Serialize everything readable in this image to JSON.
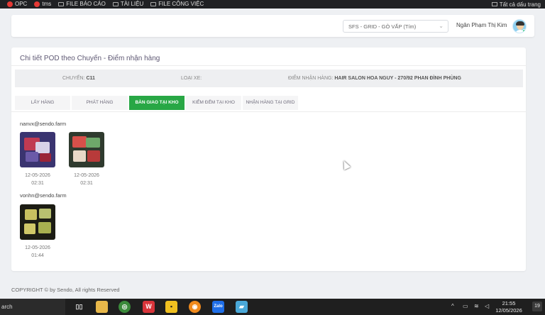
{
  "bookmarks": [
    {
      "label": "OPC",
      "icon": "red-app-icon"
    },
    {
      "label": "tms",
      "icon": "red-app-icon"
    },
    {
      "label": "FILE BÁO CÁO",
      "icon": "folder-icon"
    },
    {
      "label": "TÀI LIỆU",
      "icon": "folder-icon"
    },
    {
      "label": "FILE CÔNG VIỆC",
      "icon": "folder-icon"
    }
  ],
  "bookmarks_right": "Tất cả dấu trang",
  "header": {
    "hub_select": "SFS - GRID - GÒ VẤP (Tím)",
    "user_name": "Ngân Phạm Thị Kim"
  },
  "card": {
    "title": "Chi tiết POD theo Chuyến - Điểm nhận hàng",
    "info": {
      "trip_label": "CHUYẾN:",
      "trip_value": "C11",
      "vehicle_label": "LOẠI XE:",
      "vehicle_value": "",
      "pickup_label": "ĐIỂM NHẬN HÀNG:",
      "pickup_value": "HAIR SALON HOA NGUY - 270/92 PHAN ĐÌNH PHÙNG"
    },
    "tabs": [
      "LẤY HÀNG",
      "PHÁT HÀNG",
      "BÀN GIAO TẠI KHO",
      "KIỂM ĐẾM TẠI KHO",
      "NHẬN HÀNG TẠI GRID"
    ],
    "active_tab": "BÀN GIAO TẠI KHO",
    "groups": [
      {
        "uploader": "nanvx@sendo.farm",
        "photos": [
          {
            "date": "12-05-2026",
            "time": "02:31"
          },
          {
            "date": "12-05-2026",
            "time": "02:31"
          }
        ]
      },
      {
        "uploader": "vonhn@sendo.farm",
        "photos": [
          {
            "date": "12-05-2026",
            "time": "01:44"
          }
        ]
      }
    ]
  },
  "footer": "COPYRIGHT © by Sendo, All rights Reserved",
  "taskbar": {
    "search": "arch",
    "time": "21:55",
    "date": "12/05/2026",
    "notifications": "19"
  },
  "colors": {
    "active_tab": "#28a745",
    "page_bg": "#eef0f3"
  }
}
